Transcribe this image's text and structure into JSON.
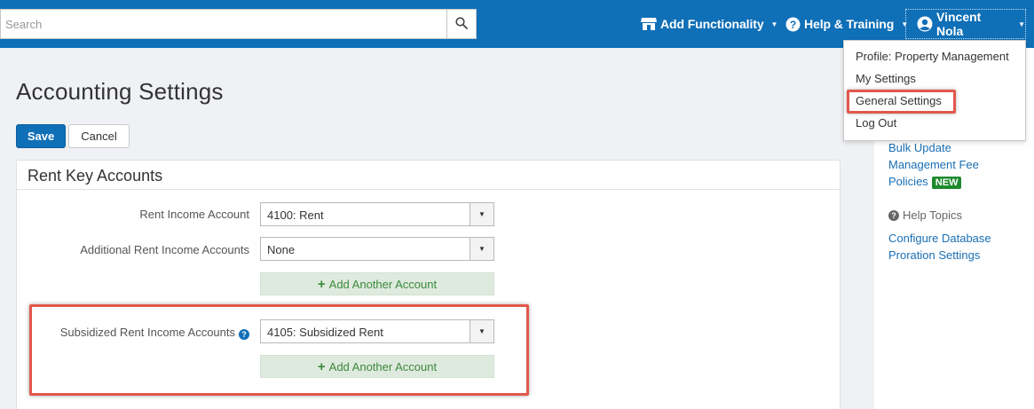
{
  "topbar": {
    "search_placeholder": "Search",
    "add_functionality": "Add Functionality",
    "help_training": "Help & Training",
    "user_name": "Vincent Nola"
  },
  "user_menu": {
    "items": [
      "Profile: Property Management",
      "My Settings",
      "General Settings",
      "Log Out"
    ],
    "highlighted_item": "General Settings"
  },
  "page": {
    "title": "Accounting Settings",
    "save_label": "Save",
    "cancel_label": "Cancel"
  },
  "panel": {
    "title": "Rent Key Accounts",
    "rent_income_label": "Rent Income Account",
    "rent_income_value": "4100: Rent",
    "additional_rent_label": "Additional Rent Income Accounts",
    "additional_rent_value": "None",
    "add_account_label": "Add Another Account",
    "subsidized_label": "Subsidized Rent Income Accounts",
    "subsidized_value": "4105: Subsidized Rent",
    "add_account_label_2": "Add Another Account"
  },
  "sidebar": {
    "bulk_update": "Bulk Update",
    "mgmt_fee": "Management Fee",
    "policies": "Policies",
    "new_badge": "NEW",
    "help_topics": "Help Topics",
    "configure_db": "Configure Database",
    "proration": "Proration Settings"
  },
  "colors": {
    "brand_blue": "#0f6fb7",
    "highlight_red": "#e2574c",
    "new_green": "#1e8a2e"
  }
}
